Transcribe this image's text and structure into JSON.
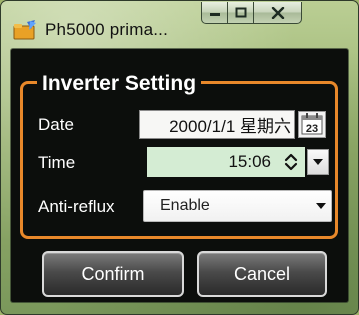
{
  "window": {
    "title": "Ph5000 prima...",
    "caption_buttons": {
      "minimize": "minimize-icon",
      "maximize": "maximize-icon",
      "close": "close-icon"
    }
  },
  "colors": {
    "group_border": "#e8882a",
    "time_field_bg": "#d4ecd3",
    "client_bg": "#0c0e0c"
  },
  "group": {
    "title": "Inverter Setting"
  },
  "fields": {
    "date": {
      "label": "Date",
      "value": "2000/1/1 星期六",
      "calendar_day": "23"
    },
    "time": {
      "label": "Time",
      "value": "15:06"
    },
    "anti_reflux": {
      "label": "Anti-reflux",
      "selected": "Enable"
    }
  },
  "buttons": {
    "confirm": "Confirm",
    "cancel": "Cancel"
  }
}
